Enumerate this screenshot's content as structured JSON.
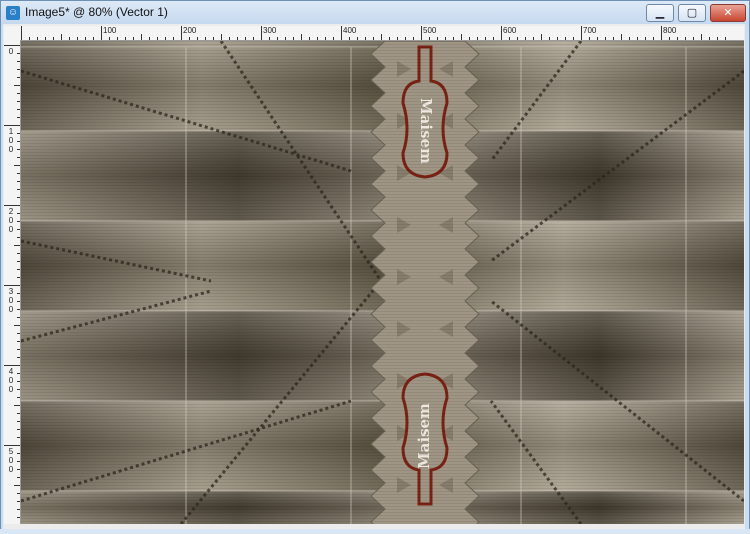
{
  "window": {
    "title": "Image5* @  80% (Vector 1)",
    "app_icon_glyph": "☺",
    "minimize_glyph": "▁",
    "maximize_glyph": "▢",
    "close_glyph": "✕",
    "frame_color": "#c9dcf1"
  },
  "ruler": {
    "top_labels": [
      "100",
      "200",
      "300",
      "400",
      "500",
      "600",
      "700",
      "800"
    ],
    "left_labels": [
      [
        "0"
      ],
      [
        "1",
        "0",
        "0"
      ],
      [
        "2",
        "0",
        "0"
      ],
      [
        "3",
        "0",
        "0"
      ],
      [
        "4",
        "0",
        "0"
      ],
      [
        "5",
        "0",
        "0"
      ]
    ]
  },
  "canvas": {
    "signature": "Maisem",
    "colors": {
      "base": "#4d4637",
      "light": "#b1a897",
      "center_strip": "#9f9585",
      "label_outline": "#7a2315",
      "signature": "#efe9df"
    }
  }
}
